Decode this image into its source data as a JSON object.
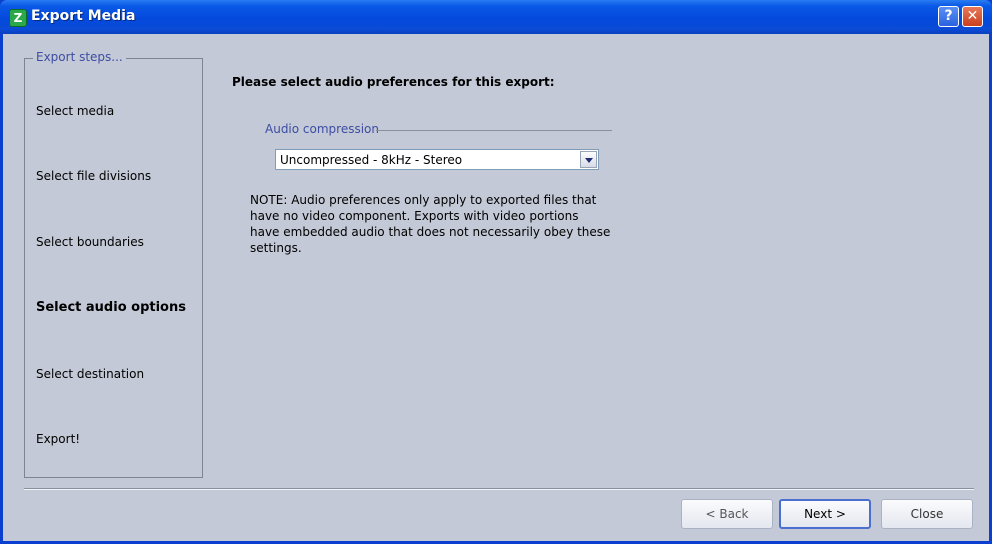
{
  "window": {
    "title": "Export Media"
  },
  "steps": {
    "legend": "Export steps...",
    "items": [
      {
        "label": "Select media"
      },
      {
        "label": "Select file divisions"
      },
      {
        "label": "Select boundaries"
      },
      {
        "label": "Select audio options"
      },
      {
        "label": "Select destination"
      },
      {
        "label": "Export!"
      }
    ]
  },
  "main": {
    "heading": "Please select audio preferences for this export:",
    "audio_group_label": "Audio compression",
    "audio_compression_value": "Uncompressed - 8kHz - Stereo",
    "note_lines": [
      "NOTE: Audio preferences only apply to exported files that",
      "have no video component.  Exports with video portions",
      "have embedded audio that does not necessarily obey these",
      "settings."
    ]
  },
  "buttons": {
    "back": "< Back",
    "next": "Next >",
    "close": "Close"
  },
  "icons": {
    "app": "app-logo-icon",
    "help": "help-icon",
    "close": "close-icon"
  },
  "colors": {
    "titlebar": "#0349dc",
    "background": "#c3c9d6",
    "legend_text": "#3d4da3"
  }
}
